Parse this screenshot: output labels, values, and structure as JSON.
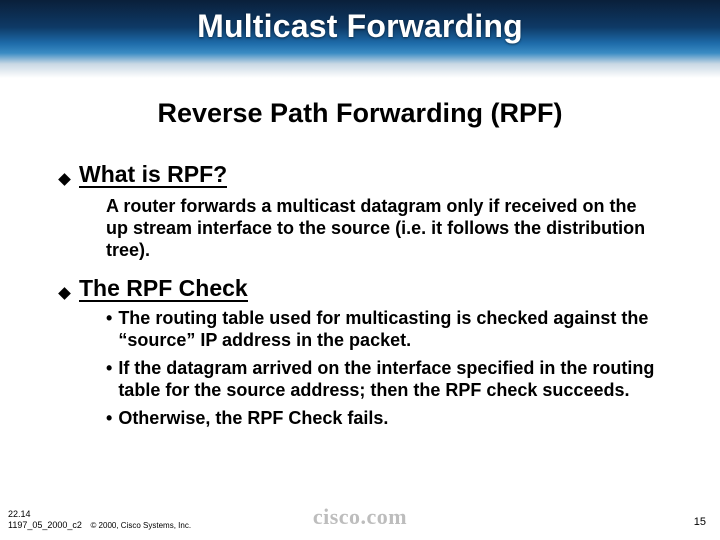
{
  "banner": {
    "title": "Multicast Forwarding"
  },
  "subtitle": "Reverse Path Forwarding (RPF)",
  "sections": [
    {
      "heading": "What is RPF?",
      "body": "A router forwards a multicast datagram only if received on the up stream interface to the source (i.e. it follows the distribution tree).",
      "subs": []
    },
    {
      "heading": "The RPF Check",
      "body": "",
      "subs": [
        "The routing table used for multicasting is checked against the “source” IP address in the packet.",
        "If the datagram arrived on the interface specified in the routing table for the source address; then the RPF check succeeds.",
        "Otherwise, the RPF Check fails."
      ]
    }
  ],
  "footer": {
    "time": "22.14",
    "code": "1197_05_2000_c2",
    "copyright": "© 2000, Cisco Systems, Inc.",
    "brand": "cisco.com",
    "page": "15"
  }
}
